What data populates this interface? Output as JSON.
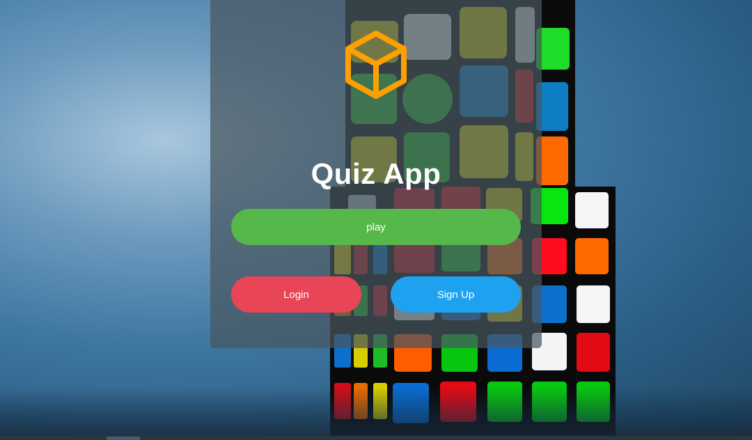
{
  "app": {
    "title": "Quiz App",
    "logo_icon": "cube-icon"
  },
  "buttons": {
    "play_label": "play",
    "login_label": "Login",
    "signup_label": "Sign Up"
  },
  "colors": {
    "logo": "#ffa000",
    "play": "#56b74a",
    "login": "#e84556",
    "signup": "#1ea2f0"
  },
  "background": {
    "image_icon": "rubiks-cube-photo"
  }
}
